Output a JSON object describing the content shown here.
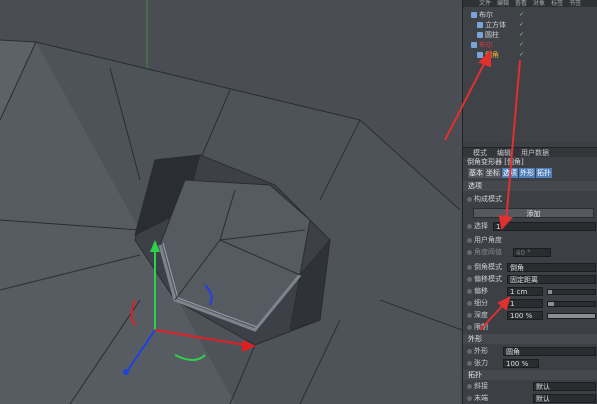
{
  "viewport": {
    "toolbar_icons": [
      "render-region-icon",
      "render-settings-icon",
      "layout-icon",
      "options-icon",
      "more-icon"
    ]
  },
  "object_manager": {
    "menu": [
      "文件",
      "编辑",
      "查看",
      "对象",
      "标签",
      "书签"
    ],
    "objects": [
      {
        "name": "布尔",
        "color": "#d7d7d7",
        "icon": "boolean-icon",
        "indent": 0
      },
      {
        "name": "立方体",
        "color": "#d7d7d7",
        "icon": "cube-icon",
        "indent": 1
      },
      {
        "name": "圆柱",
        "color": "#d7d7d7",
        "icon": "cylinder-icon",
        "indent": 1
      },
      {
        "name": "布尔",
        "color": "#d43c3c",
        "icon": "boolean-icon",
        "indent": 0
      },
      {
        "name": "倒角",
        "color": "#f2b233",
        "icon": "bevel-icon",
        "indent": 1
      }
    ]
  },
  "attributes": {
    "menu": [
      "模式",
      "编辑",
      "用户数据"
    ],
    "title": "倒角变形器 [倒角]",
    "tabs": [
      {
        "label": "基本",
        "active": false
      },
      {
        "label": "坐标",
        "active": false
      },
      {
        "label": "选项",
        "active": true
      },
      {
        "label": "外形",
        "active": true
      },
      {
        "label": "拓扑",
        "active": true
      }
    ],
    "section_options": "选项",
    "component_mode_label": "构成模式",
    "add_button": "添加",
    "selection_label": "选择",
    "selection_value": "1",
    "use_angle_label": "用户角度",
    "angle_threshold_label": "角度阈值",
    "angle_threshold_value": "40 °",
    "bevel_mode_label": "倒角模式",
    "bevel_mode_value": "倒角",
    "offset_mode_label": "偏移模式",
    "offset_mode_value": "固定距离",
    "offset_label": "偏移",
    "offset_value": "1 cm",
    "subdivision_label": "细分",
    "subdivision_value": "1",
    "subdivision_fill": 0.12,
    "depth_label": "深度",
    "depth_value": "100 %",
    "depth_fill": 1.0,
    "limit_label": "限制",
    "section_shape": "外形",
    "shape_label": "外形",
    "shape_value": "圆角",
    "tension_label": "张力",
    "tension_value": "100 %",
    "section_topology": "拓扑",
    "miter_label": "斜接",
    "miter_value": "默认",
    "end_label": "末端",
    "end_value": "默认"
  },
  "colors": {
    "accent_tab": "#4f7fb8",
    "annotation_arrow": "#e03030",
    "axis_y": "#2ed24a",
    "axis_x": "#e02020",
    "axis_z": "#2040e0"
  }
}
